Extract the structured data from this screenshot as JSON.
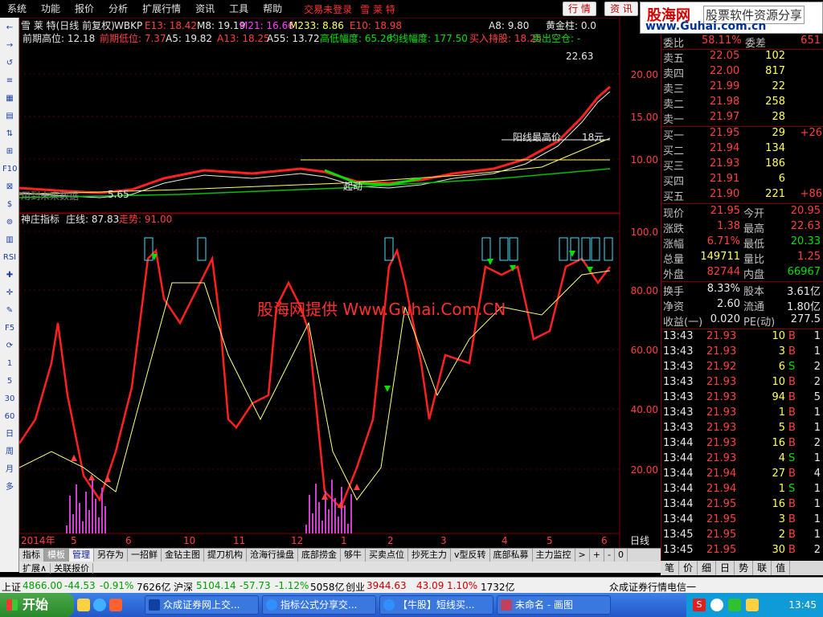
{
  "menu": [
    "系统",
    "功能",
    "报价",
    "分析",
    "扩展行情",
    "资讯",
    "工具",
    "帮助"
  ],
  "menu_warn": "交易未登录",
  "menu_stock": "雪 莱 特",
  "menu_btns": [
    "行 情",
    "资 讯"
  ],
  "brand": {
    "name": "股海网",
    "slogan": "股票软件资源分享",
    "url": "www.Guhai.com.cn"
  },
  "left_tools": [
    "←",
    "→",
    "↺",
    "≡",
    "▦",
    "▤",
    "⇅",
    "⊞",
    "F10",
    "⊠",
    "$",
    "⊚",
    "▥",
    "RSI",
    "✚",
    "✛",
    "✎",
    "F5",
    "⟳",
    "1",
    "5",
    "30",
    "60",
    "日",
    "周",
    "月",
    "多"
  ],
  "chart_header": {
    "stock": "雪 莱 特(日线 前复权)",
    "indicator": "WBKP",
    "ma": [
      {
        "text": "E13: 18.42",
        "color": "#ff4040"
      },
      {
        "text": "M8: 19.19",
        "color": "#e8e8e8"
      },
      {
        "text": "M21: 16.66",
        "color": "#ff40ff"
      },
      {
        "text": "M233: 8.86",
        "color": "#ffff60"
      },
      {
        "text": "E10: 18.98",
        "color": "#ff4040"
      },
      {
        "text": "A8: 9.80",
        "color": "#e8e8e8"
      },
      {
        "text": "黄金柱: 0.0",
        "color": "#e8e8e8"
      }
    ],
    "line2": [
      {
        "text": "前期高位: 12.18",
        "color": "#e8e8e8"
      },
      {
        "text": "前期低位: 7.37",
        "color": "#ff4040"
      },
      {
        "text": "A5: 19.82",
        "color": "#e8e8e8"
      },
      {
        "text": "A13: 18.25",
        "color": "#ff4040"
      },
      {
        "text": "A55: 13.72",
        "color": "#e8e8e8"
      },
      {
        "text": "高低幅度: 65.26",
        "color": "#00e000"
      },
      {
        "text": "均线幅度: 177.50",
        "color": "#00e000"
      },
      {
        "text": "买入持股: 18.25",
        "color": "#ff4040"
      },
      {
        "text": "卖出空仓: -",
        "color": "#00e000"
      }
    ],
    "price_labels": {
      "high": "22.63",
      "yang": "阳线最高价",
      "yang_val": "18元",
      "low": "5.65",
      "qidong": "起动",
      "hint": "用到未来数据"
    },
    "price_axis": [
      "20.00",
      "15.00",
      "10.00"
    ],
    "lower_title": "神庄指标",
    "lower_vals": [
      {
        "text": "庄线: 87.83",
        "color": "#e8e8e8"
      },
      {
        "text": "走势: 91.00",
        "color": "#ff4040"
      }
    ],
    "lower_axis": [
      "100.0",
      "80.00",
      "60.00",
      "40.00",
      "20.00"
    ],
    "watermark": "股海网提供 Www.Guhai.Com.CN",
    "x_axis": [
      {
        "label": "2014年",
        "color": "#ff4040"
      },
      {
        "label": "5",
        "color": "#ff4040"
      },
      {
        "label": "6",
        "color": "#ff4040"
      },
      {
        "label": "10",
        "color": "#ff4040"
      },
      {
        "label": "11",
        "color": "#ff4040"
      },
      {
        "label": "12",
        "color": "#ff4040"
      },
      {
        "label": "1",
        "color": "#ff4040"
      },
      {
        "label": "2",
        "color": "#ff4040"
      },
      {
        "label": "3",
        "color": "#ff4040"
      },
      {
        "label": "4",
        "color": "#ff4040"
      },
      {
        "label": "5",
        "color": "#ff4040"
      },
      {
        "label": "6",
        "color": "#ff4040"
      }
    ],
    "period": "日线"
  },
  "quote": {
    "weibi": {
      "label": "委比",
      "value": "58.11%",
      "label2": "委差",
      "value2": "651"
    },
    "sell": [
      {
        "l": "卖五",
        "p": "22.05",
        "v": "102"
      },
      {
        "l": "卖四",
        "p": "22.00",
        "v": "817"
      },
      {
        "l": "卖三",
        "p": "21.99",
        "v": "22"
      },
      {
        "l": "卖二",
        "p": "21.98",
        "v": "258"
      },
      {
        "l": "卖一",
        "p": "21.97",
        "v": "28"
      }
    ],
    "buy": [
      {
        "l": "买一",
        "p": "21.95",
        "v": "29",
        "c": "+26"
      },
      {
        "l": "买二",
        "p": "21.94",
        "v": "134",
        "c": ""
      },
      {
        "l": "买三",
        "p": "21.93",
        "v": "186",
        "c": ""
      },
      {
        "l": "买四",
        "p": "21.91",
        "v": "6",
        "c": ""
      },
      {
        "l": "买五",
        "p": "21.90",
        "v": "221",
        "c": "+86"
      }
    ],
    "stats": [
      {
        "l1": "现价",
        "v1": "21.95",
        "c1": "red",
        "l2": "今开",
        "v2": "20.95",
        "c2": "red"
      },
      {
        "l1": "涨跌",
        "v1": "1.38",
        "c1": "red",
        "l2": "最高",
        "v2": "22.63",
        "c2": "red"
      },
      {
        "l1": "涨幅",
        "v1": "6.71%",
        "c1": "red",
        "l2": "最低",
        "v2": "20.33",
        "c2": "grn"
      },
      {
        "l1": "总量",
        "v1": "149711",
        "c1": "yel",
        "l2": "量比",
        "v2": "1.25",
        "c2": "red"
      },
      {
        "l1": "外盘",
        "v1": "82744",
        "c1": "red",
        "l2": "内盘",
        "v2": "66967",
        "c2": "grn"
      }
    ],
    "stats2": [
      {
        "l1": "换手",
        "v1": "8.33%",
        "l2": "股本",
        "v2": "3.61亿"
      },
      {
        "l1": "净资",
        "v1": "2.60",
        "l2": "流通",
        "v2": "1.80亿"
      },
      {
        "l1": "收益(一)",
        "v1": "0.020",
        "l2": "PE(动)",
        "v2": "277.5"
      }
    ],
    "ticks": [
      {
        "t": "13:43",
        "p": "21.93",
        "v": "10",
        "s": "B",
        "n": "1"
      },
      {
        "t": "13:43",
        "p": "21.93",
        "v": "3",
        "s": "B",
        "n": "1"
      },
      {
        "t": "13:43",
        "p": "21.92",
        "v": "6",
        "s": "S",
        "n": "2"
      },
      {
        "t": "13:43",
        "p": "21.93",
        "v": "10",
        "s": "B",
        "n": "2"
      },
      {
        "t": "13:43",
        "p": "21.93",
        "v": "94",
        "s": "B",
        "n": "5"
      },
      {
        "t": "13:43",
        "p": "21.93",
        "v": "1",
        "s": "B",
        "n": "1"
      },
      {
        "t": "13:43",
        "p": "21.93",
        "v": "5",
        "s": "B",
        "n": "1"
      },
      {
        "t": "13:44",
        "p": "21.93",
        "v": "16",
        "s": "B",
        "n": "2"
      },
      {
        "t": "13:44",
        "p": "21.93",
        "v": "4",
        "s": "S",
        "n": "1"
      },
      {
        "t": "13:44",
        "p": "21.94",
        "v": "27",
        "s": "B",
        "n": "4"
      },
      {
        "t": "13:44",
        "p": "21.94",
        "v": "1",
        "s": "S",
        "n": "1"
      },
      {
        "t": "13:44",
        "p": "21.95",
        "v": "16",
        "s": "B",
        "n": "1"
      },
      {
        "t": "13:44",
        "p": "21.95",
        "v": "3",
        "s": "B",
        "n": "1"
      },
      {
        "t": "13:45",
        "p": "21.95",
        "v": "2",
        "s": "B",
        "n": "1"
      },
      {
        "t": "13:45",
        "p": "21.95",
        "v": "30",
        "s": "B",
        "n": "2"
      }
    ]
  },
  "tabs": [
    "指标",
    "模板",
    "管理",
    "另存为",
    "一招鲜",
    "金钻主图",
    "提刀机构",
    "沧海行操盘",
    "底部捞金",
    "够牛",
    "买卖点位",
    "抄死主力",
    "v型反转",
    "底部私募",
    "主力监控"
  ],
  "tab_nav": [
    ">",
    "+",
    "-",
    "0"
  ],
  "expand": [
    "扩展∧",
    "关联报价"
  ],
  "right_btm": [
    "笔",
    "价",
    "细",
    "日",
    "势",
    "联",
    "值"
  ],
  "status": [
    {
      "t": "上证",
      "c": "#000"
    },
    {
      "t": "4866.00",
      "c": "#00a000"
    },
    {
      "t": "-44.53",
      "c": "#00a000"
    },
    {
      "t": "-0.91%",
      "c": "#00a000"
    },
    {
      "t": "7626亿",
      "c": "#000"
    },
    {
      "t": "沪深",
      "c": "#000"
    },
    {
      "t": "5104.14",
      "c": "#00a000"
    },
    {
      "t": "-57.73",
      "c": "#00a000"
    },
    {
      "t": "-1.12%",
      "c": "#00a000"
    },
    {
      "t": "5058亿",
      "c": "#000"
    },
    {
      "t": "创业",
      "c": "#000"
    },
    {
      "t": "3944.63",
      "c": "#d00000"
    },
    {
      "t": "43.09",
      "c": "#d00000"
    },
    {
      "t": "1.10%",
      "c": "#d00000"
    },
    {
      "t": "1732亿",
      "c": "#000"
    },
    {
      "t": "众成证券行情电信一",
      "c": "#000"
    }
  ],
  "taskbar": {
    "start": "开始",
    "tasks": [
      "众成证券网上交...",
      "指标公式分享交...",
      "【牛股】短线买...",
      "未命名 - 画图"
    ],
    "clock": "13:45"
  }
}
